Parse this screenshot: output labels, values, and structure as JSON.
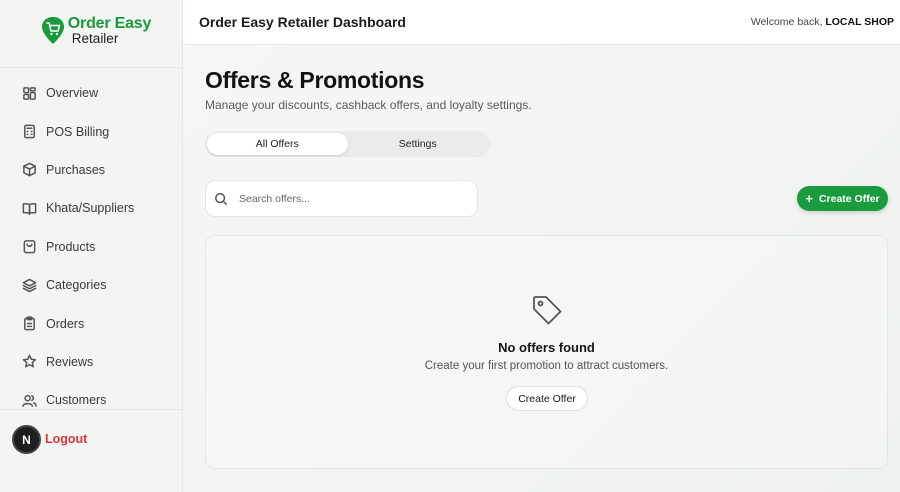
{
  "brand": {
    "name": "Order Easy",
    "sub": "Retailer"
  },
  "sidebar": {
    "items": [
      {
        "label": "Overview",
        "icon": "grid-icon"
      },
      {
        "label": "POS Billing",
        "icon": "calculator-icon"
      },
      {
        "label": "Purchases",
        "icon": "package-icon"
      },
      {
        "label": "Khata/Suppliers",
        "icon": "book-icon"
      },
      {
        "label": "Products",
        "icon": "shopping-bag-icon"
      },
      {
        "label": "Categories",
        "icon": "layers-icon"
      },
      {
        "label": "Orders",
        "icon": "clipboard-icon"
      },
      {
        "label": "Reviews",
        "icon": "star-icon"
      },
      {
        "label": "Customers",
        "icon": "users-icon"
      }
    ],
    "logout_label": "Logout",
    "avatar_letter": "N"
  },
  "header": {
    "title": "Order Easy Retailer Dashboard",
    "welcome_prefix": "Welcome back,",
    "shop_name": "LOCAL SHOP"
  },
  "main": {
    "title": "Offers & Promotions",
    "subtitle": "Manage your discounts, cashback offers, and loyalty settings.",
    "tabs": [
      {
        "label": "All Offers",
        "active": true
      },
      {
        "label": "Settings",
        "active": false
      }
    ],
    "search": {
      "placeholder": "Search offers...",
      "value": ""
    },
    "create_button_label": "Create Offer",
    "empty": {
      "title": "No offers found",
      "subtitle": "Create your first promotion to attract customers.",
      "button_label": "Create Offer"
    }
  },
  "colors": {
    "accent": "#1a9c3e",
    "logout": "#d9363e"
  }
}
